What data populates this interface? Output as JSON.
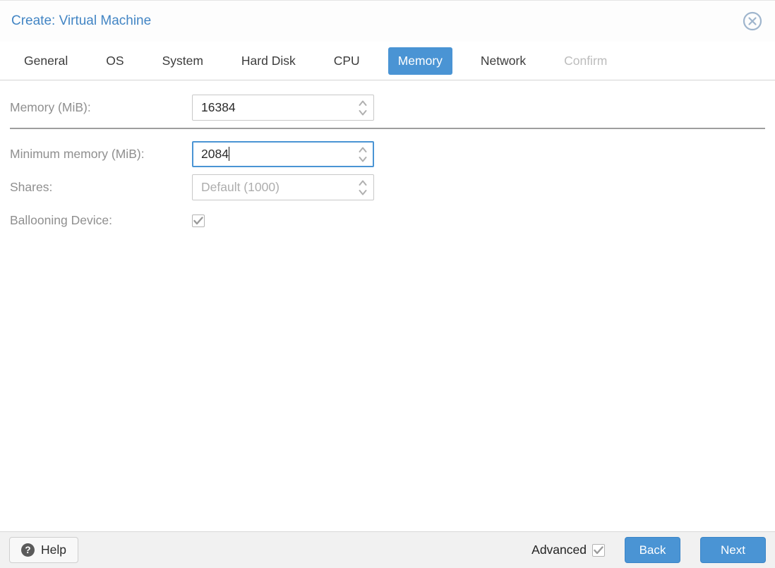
{
  "dialog": {
    "title": "Create: Virtual Machine"
  },
  "tabs": [
    {
      "label": "General",
      "state": "normal"
    },
    {
      "label": "OS",
      "state": "normal"
    },
    {
      "label": "System",
      "state": "normal"
    },
    {
      "label": "Hard Disk",
      "state": "normal"
    },
    {
      "label": "CPU",
      "state": "normal"
    },
    {
      "label": "Memory",
      "state": "active"
    },
    {
      "label": "Network",
      "state": "normal"
    },
    {
      "label": "Confirm",
      "state": "disabled"
    }
  ],
  "form": {
    "memory": {
      "label": "Memory (MiB):",
      "value": "16384",
      "control": "number-spinner"
    },
    "min_memory": {
      "label": "Minimum memory (MiB):",
      "value": "2084",
      "control": "number-spinner",
      "focused": true
    },
    "shares": {
      "label": "Shares:",
      "value": "Default (1000)",
      "control": "number-spinner",
      "disabled": true
    },
    "ballooning": {
      "label": "Ballooning Device:",
      "control": "checkbox",
      "checked": true
    }
  },
  "footer": {
    "help_label": "Help",
    "help_icon": "question-mark-circle",
    "advanced_label": "Advanced",
    "advanced_checked": true,
    "back_label": "Back",
    "next_label": "Next"
  },
  "icons": {
    "close": "circle-x",
    "spinner": "chevron-up-down",
    "check": "checkmark"
  },
  "colors": {
    "title_blue": "#4285c4",
    "accent_blue": "#4a94d4",
    "tab_text": "#3c3c3c",
    "disabled_tab": "#bcbcbc",
    "label_gray": "#8f8f8f",
    "placeholder_gray": "#adadad",
    "input_border": "#c8c8c8",
    "focus_border": "#4a94d4",
    "divider": "#9e9e9e",
    "footer_bg": "#f1f1f1",
    "close_icon": "#9fb5cd"
  }
}
